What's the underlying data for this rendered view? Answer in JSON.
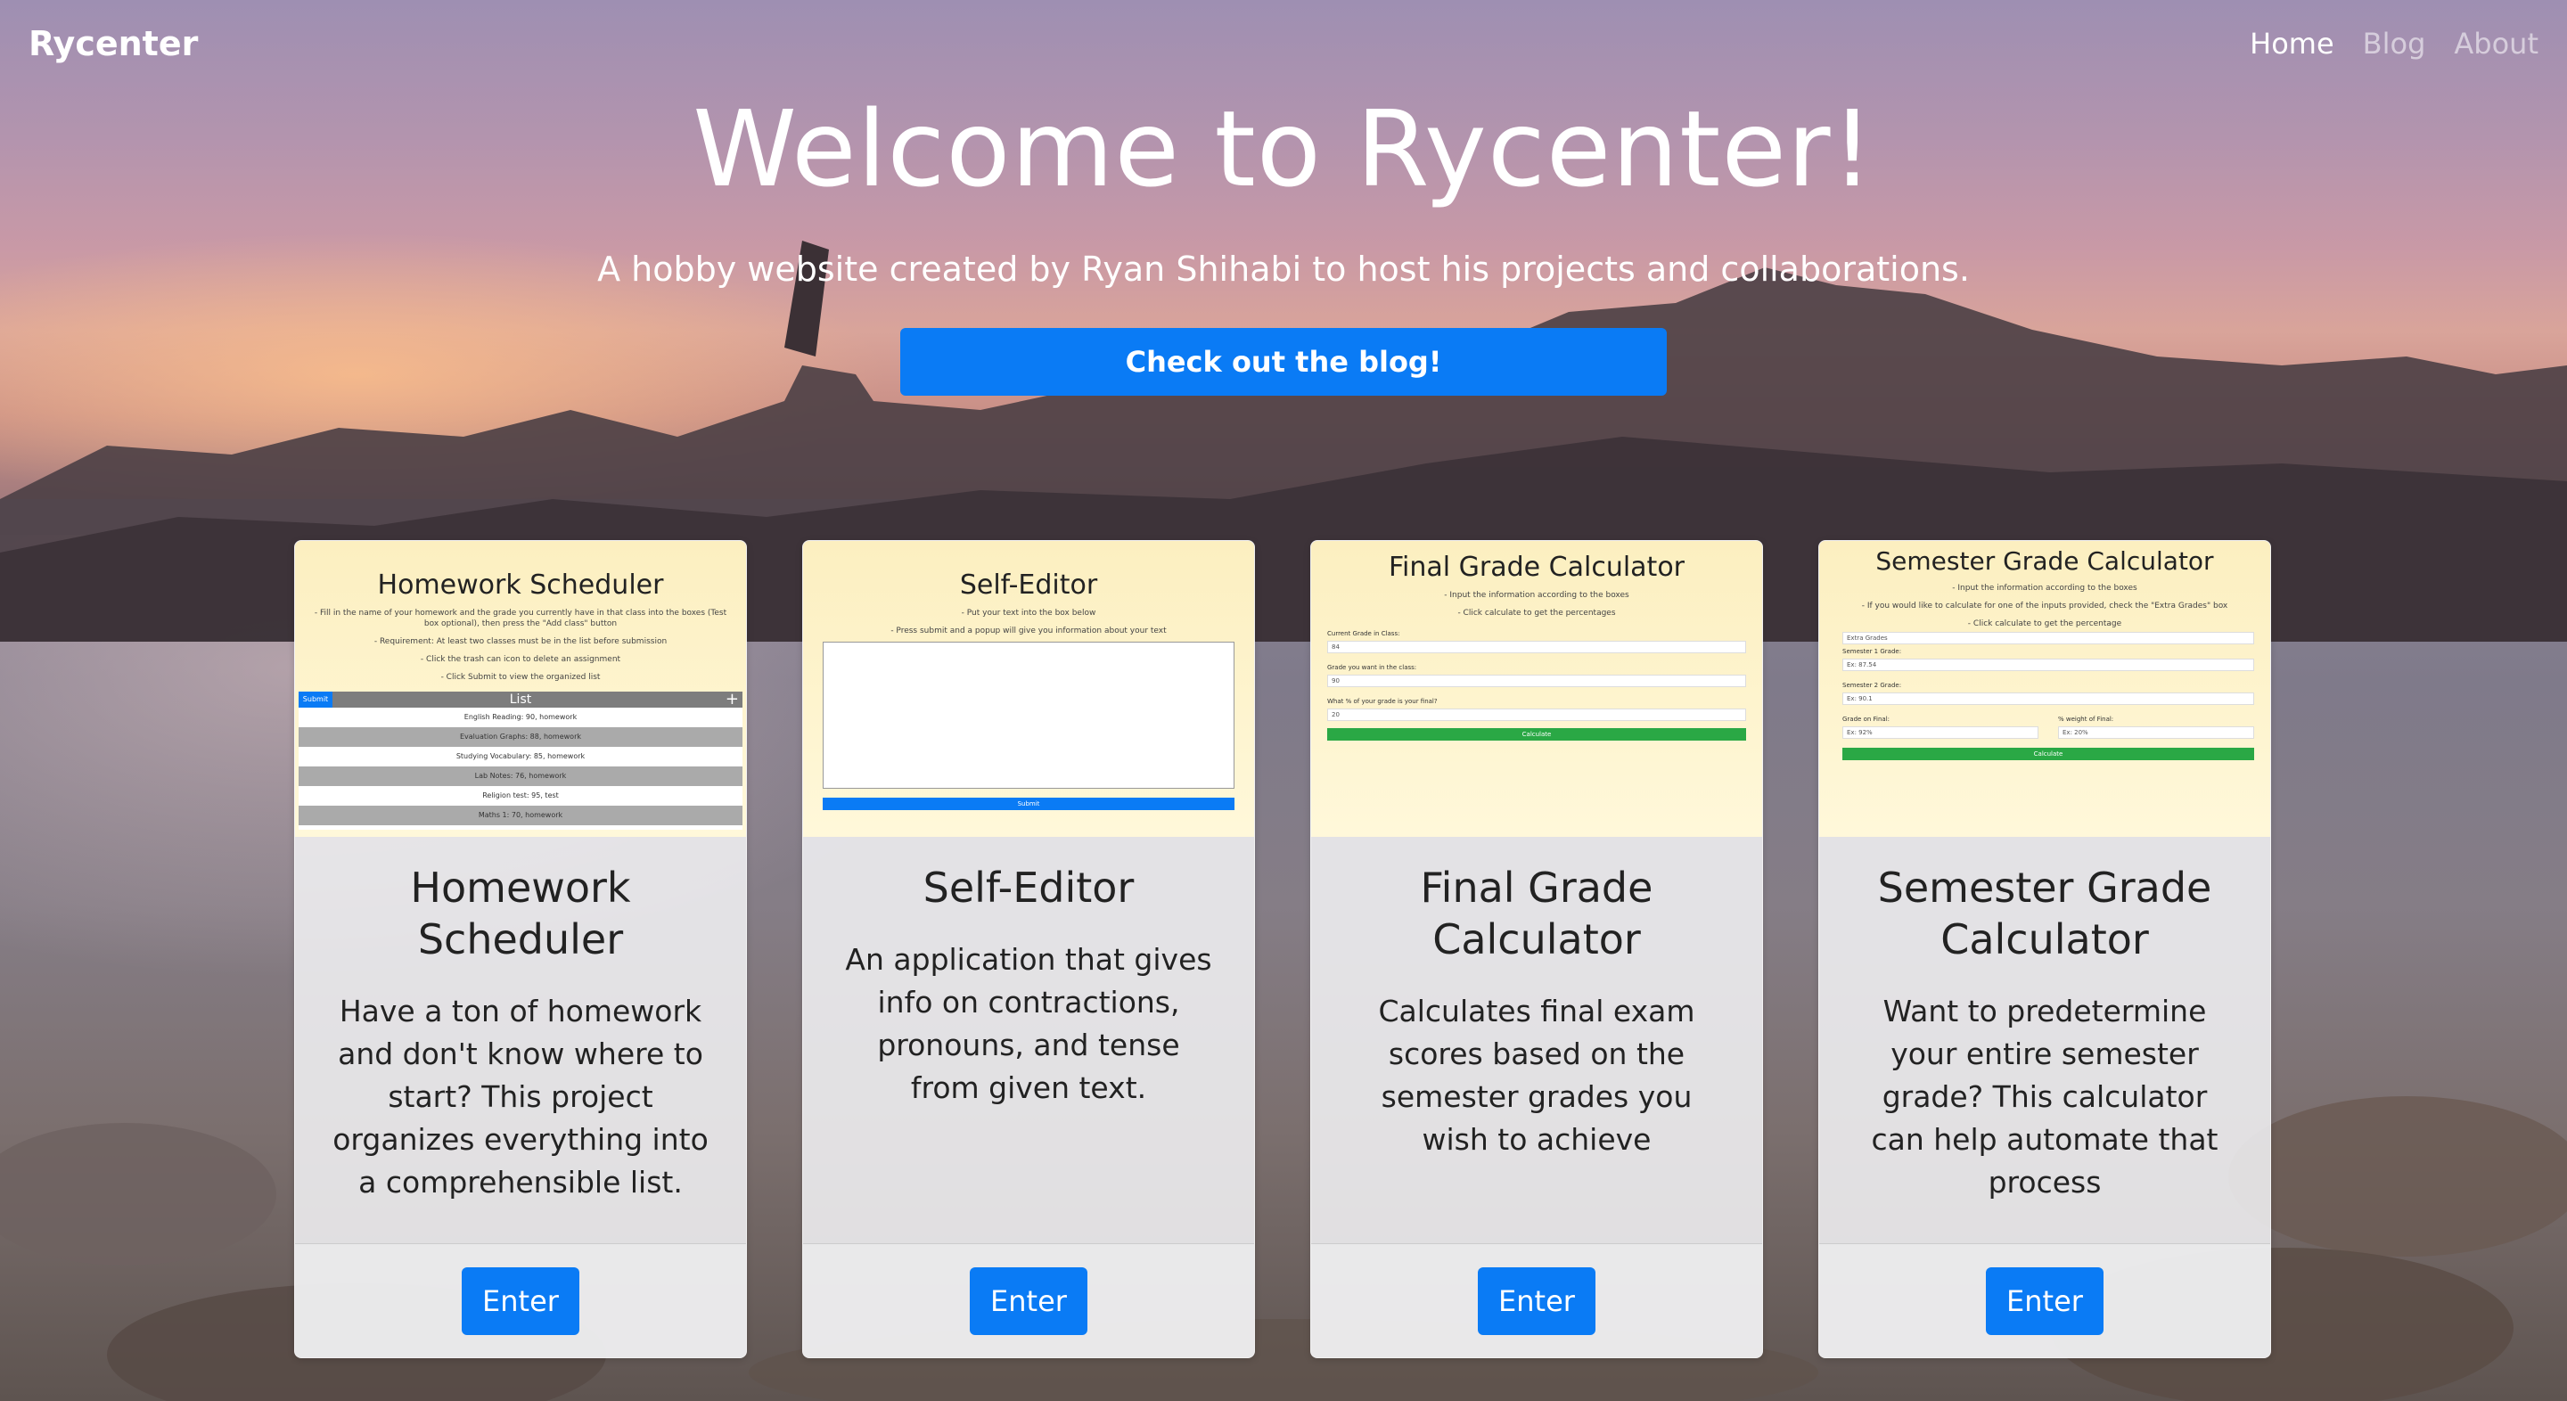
{
  "navbar": {
    "brand": "Rycenter",
    "links": [
      {
        "label": "Home",
        "active": true
      },
      {
        "label": "Blog",
        "active": false
      },
      {
        "label": "About",
        "active": false
      }
    ]
  },
  "hero": {
    "title": "Welcome to Rycenter!",
    "subtitle": "A hobby website created by Ryan Shihabi to host his projects and collaborations.",
    "cta_label": "Check out the blog!"
  },
  "colors": {
    "primary": "#0a7bf5",
    "success": "#2aa845",
    "thumb_bg": "#fcefc0"
  },
  "cards": [
    {
      "thumb_title": "Homework Scheduler",
      "thumb_lines": [
        "- Fill in the name of your homework and the grade you currently have in that class into the boxes (Test box optional), then press the \"Add class\" button",
        "- Requirement: At least two classes must be in the list before submission",
        "- Click the trash can icon to delete an assignment",
        "- Click Submit to view the organized list"
      ],
      "thumb_list_header": "List",
      "thumb_submit": "Submit",
      "thumb_rows": [
        "English Reading: 90, homework",
        "Evaluation Graphs: 88, homework",
        "Studying Vocabulary: 85, homework",
        "Lab Notes: 76, homework",
        "Religion test: 95, test",
        "Maths 1: 70, homework"
      ],
      "title": "Homework Scheduler",
      "text": "Have a ton of homework and don't know where to start? This project organizes everything into a comprehensible list.",
      "button": "Enter"
    },
    {
      "thumb_title": "Self-Editor",
      "thumb_lines": [
        "- Put your text into the box below",
        "- Press submit and a popup will give you information about your text"
      ],
      "thumb_submit": "Submit",
      "title": "Self-Editor",
      "text": "An application that gives info on contractions, pronouns, and tense from given text.",
      "button": "Enter"
    },
    {
      "thumb_title": "Final Grade Calculator",
      "thumb_lines": [
        "- Input the information according to the boxes",
        "- Click calculate to get the percentages"
      ],
      "thumb_fields": [
        {
          "label": "Current Grade in Class:",
          "value": "84"
        },
        {
          "label": "Grade you want in the class:",
          "value": "90"
        },
        {
          "label": "What % of your grade is your final?",
          "value": "20"
        }
      ],
      "thumb_button": "Calculate",
      "title": "Final Grade Calculator",
      "text": "Calculates final exam scores based on the semester grades you wish to achieve",
      "button": "Enter"
    },
    {
      "thumb_title": "Semester Grade Calculator",
      "thumb_lines": [
        "- Input the information according to the boxes",
        "- If you would like to calculate for one of the inputs provided, check the \"Extra Grades\" box",
        "- Click calculate to get the percentage"
      ],
      "thumb_select": "Extra Grades",
      "thumb_fields": [
        {
          "label": "Semester 1 Grade:",
          "value": "Ex: 87.54"
        },
        {
          "label": "Semester 2 Grade:",
          "value": "Ex: 90.1"
        },
        {
          "label": "Grade on Final:",
          "value": "Ex: 92%"
        },
        {
          "label": "% weight of Final:",
          "value": "Ex: 20%"
        }
      ],
      "thumb_button": "Calculate",
      "title": "Semester Grade Calculator",
      "text": "Want to predetermine your entire semester grade? This calculator can help automate that process",
      "button": "Enter"
    }
  ]
}
